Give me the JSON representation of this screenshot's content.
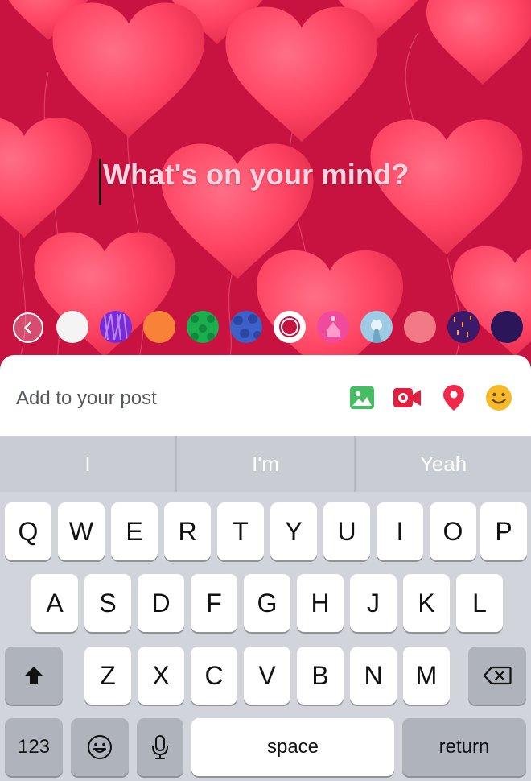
{
  "composer": {
    "placeholder": "What's on your mind?",
    "background_color": "#c8123f",
    "heart_color": "#ff4060"
  },
  "swatches": {
    "collapse_icon": "chevron-left-icon",
    "items": [
      {
        "name": "white",
        "color": "#f4f4f4"
      },
      {
        "name": "purple-pattern",
        "color": "#7b2bd6"
      },
      {
        "name": "orange",
        "color": "#f88238"
      },
      {
        "name": "green-pattern",
        "color": "#1cae4e"
      },
      {
        "name": "blue-pattern",
        "color": "#3e61c9"
      },
      {
        "name": "hearts-selected",
        "color": "#c8123f"
      },
      {
        "name": "pink-pattern",
        "color": "#f04a9a"
      },
      {
        "name": "light-blue-scene",
        "color": "#9ccbe3"
      },
      {
        "name": "salmon",
        "color": "#f27a86"
      },
      {
        "name": "purple-rain",
        "color": "#3b1a6a"
      },
      {
        "name": "navy",
        "color": "#2a1658"
      }
    ]
  },
  "add_to_post": {
    "label": "Add to your post",
    "tools": [
      {
        "name": "photo-icon",
        "color": "#45bd62"
      },
      {
        "name": "video-camera-icon",
        "color": "#e41e3f"
      },
      {
        "name": "location-pin-icon",
        "color": "#f02849"
      },
      {
        "name": "emoji-icon",
        "color": "#f7b928"
      }
    ]
  },
  "keyboard": {
    "suggestions": [
      "I",
      "I'm",
      "Yeah"
    ],
    "row1": [
      "Q",
      "W",
      "E",
      "R",
      "T",
      "Y",
      "U",
      "I",
      "O",
      "P"
    ],
    "row2": [
      "A",
      "S",
      "D",
      "F",
      "G",
      "H",
      "J",
      "K",
      "L"
    ],
    "row3": [
      "Z",
      "X",
      "C",
      "V",
      "B",
      "N",
      "M"
    ],
    "numbers_label": "123",
    "space_label": "space",
    "return_label": "return"
  }
}
